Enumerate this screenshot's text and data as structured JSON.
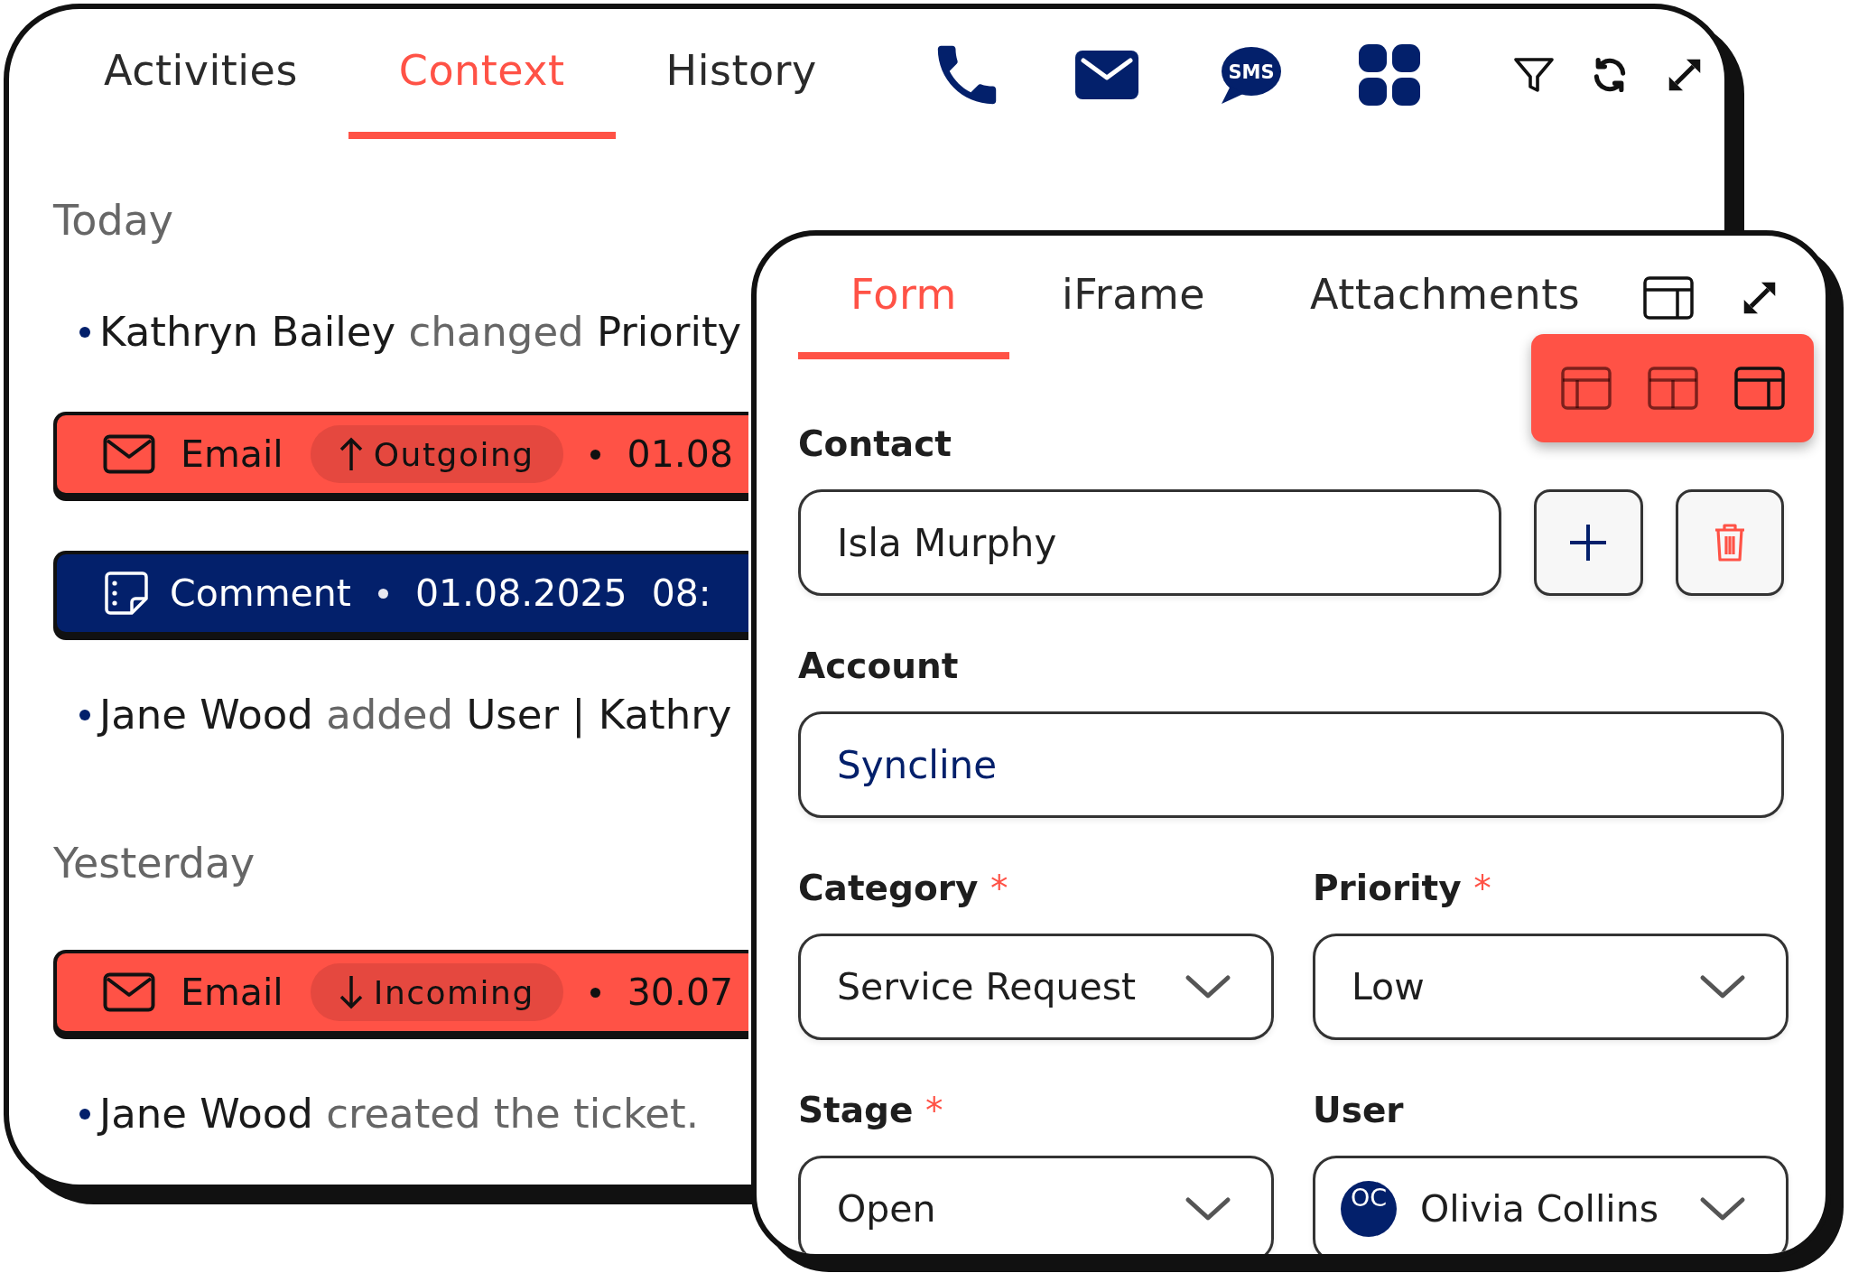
{
  "activity_tabs": [
    {
      "label": "Activities",
      "selected": false
    },
    {
      "label": "Context",
      "selected": true
    },
    {
      "label": "History",
      "selected": false
    }
  ],
  "channel_buttons": [
    {
      "kind": "phone"
    },
    {
      "kind": "email"
    },
    {
      "kind": "sms",
      "label": "SMS"
    },
    {
      "kind": "apps"
    }
  ],
  "tool_buttons": [
    {
      "kind": "filter"
    },
    {
      "kind": "refresh"
    },
    {
      "kind": "expand"
    }
  ],
  "timeline": [
    {
      "heading": "Today",
      "entries": [
        {
          "kind": "change",
          "actor": "Kathryn Bailey",
          "action": "changed",
          "object": "Priority"
        },
        {
          "kind": "email",
          "label": "Email",
          "direction": {
            "kind": "outgoing",
            "label": "Outgoing"
          },
          "date": "01.08"
        },
        {
          "kind": "comment",
          "label": "Comment",
          "date": "01.08.2025 08:"
        },
        {
          "kind": "change",
          "actor": "Jane Wood",
          "action": "added",
          "object": "User | Kathry"
        }
      ]
    },
    {
      "heading": "Yesterday",
      "entries": [
        {
          "kind": "email",
          "label": "Email",
          "direction": {
            "kind": "incoming",
            "label": "Incoming"
          },
          "date": "30.07"
        },
        {
          "kind": "change",
          "actor": "Jane Wood",
          "action": "created the ticket."
        }
      ]
    }
  ],
  "detail_tabs": [
    {
      "label": "Form",
      "selected": true
    },
    {
      "label": "iFrame",
      "selected": false
    },
    {
      "label": "Attachments",
      "selected": false
    }
  ],
  "layout_options": [
    {
      "kind": "left",
      "selected": false
    },
    {
      "kind": "center",
      "selected": false
    },
    {
      "kind": "right",
      "selected": true
    }
  ],
  "form": {
    "required_mark": "*",
    "contact": {
      "label": "Contact",
      "value": "Isla Murphy",
      "linked": false
    },
    "account": {
      "label": "Account",
      "value": "Syncline",
      "linked": true
    },
    "selects": [
      {
        "label": "Category",
        "required": true,
        "value": "Service Request"
      },
      {
        "label": "Priority",
        "required": true,
        "value": "Low"
      },
      {
        "label": "Stage",
        "required": true,
        "value": "Open"
      },
      {
        "label": "User",
        "required": false,
        "value": "Olivia Collins",
        "avatar": "OC"
      }
    ]
  }
}
